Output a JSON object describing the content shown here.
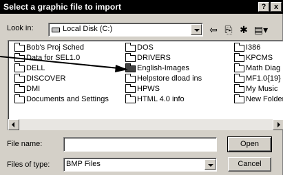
{
  "window": {
    "title": "Select a graphic file to import",
    "help_label": "?",
    "close_label": "x"
  },
  "lookin": {
    "label": "Look in:",
    "value": "Local Disk (C:)"
  },
  "toolbar": {
    "back_glyph": "⇦",
    "up_glyph": "⎘",
    "newfolder_glyph": "✱",
    "views_glyph": "▤▾"
  },
  "files": {
    "col1": [
      "Bob's Proj Sched",
      "Data for SEL1.0",
      "DELL",
      "DISCOVER",
      "DMI",
      "Documents and Settings"
    ],
    "col2": [
      "DOS",
      "DRIVERS",
      "English-Images",
      "Helpstore dload ins",
      "HPWS",
      "HTML 4.0 info"
    ],
    "col3": [
      "I386",
      "KPCMS",
      "Math Diag R",
      "MF1.0{19}",
      "My Music",
      "New Folder"
    ]
  },
  "filename": {
    "label": "File name:",
    "value": ""
  },
  "filetype": {
    "label": "Files of type:",
    "value": "BMP Files"
  },
  "buttons": {
    "open": "Open",
    "cancel": "Cancel"
  },
  "colors": {
    "titlebar": "#000000",
    "dialog": "#d4d0c8",
    "list_bg": "#ffffff"
  }
}
